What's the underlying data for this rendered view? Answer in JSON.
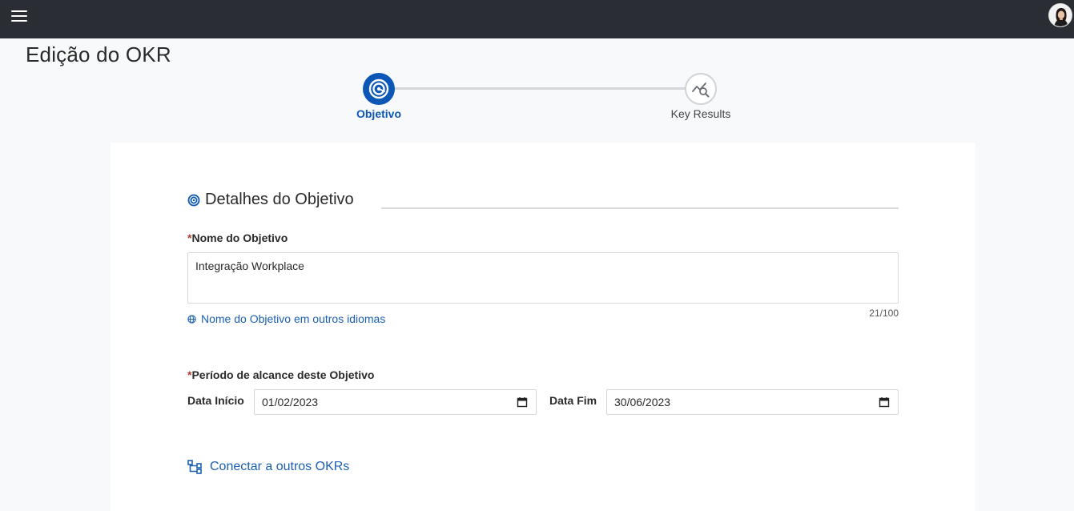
{
  "header": {
    "menu_icon": "hamburger-icon",
    "avatar_icon": "user-avatar"
  },
  "page": {
    "title": "Edição do OKR"
  },
  "stepper": {
    "steps": [
      {
        "label": "Objetivo",
        "icon": "target-icon",
        "active": true
      },
      {
        "label": "Key Results",
        "icon": "chart-search-icon",
        "active": false
      }
    ]
  },
  "details": {
    "section_title": "Detalhes do Objetivo",
    "section_icon": "target-icon",
    "name_label_required": "*",
    "name_label": "Nome do Objetivo",
    "name_value": "Integração Workplace",
    "name_counter": "21/100",
    "other_languages_link": "Nome do Objetivo em outros idiomas",
    "period_label_required": "*",
    "period_label": "Período de alcance deste Objetivo",
    "start_label": "Data Início",
    "start_value": "01/02/2023",
    "end_label": "Data Fim",
    "end_value": "30/06/2023",
    "connect_link": "Conectar a outros OKRs"
  },
  "colors": {
    "topbar": "#2b2d35",
    "accent": "#0b57b5",
    "link": "#1a5fb4",
    "required": "#b23a2b"
  }
}
